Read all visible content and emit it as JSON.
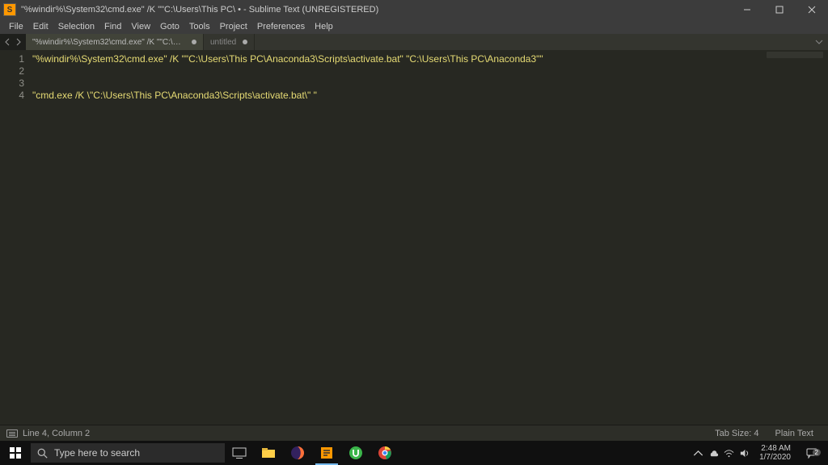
{
  "window": {
    "title": "\"%windir%\\System32\\cmd.exe\" /K \"\"C:\\Users\\This PC\\ • - Sublime Text (UNREGISTERED)",
    "app_icon_letter": "S"
  },
  "menu": {
    "items": [
      "File",
      "Edit",
      "Selection",
      "Find",
      "View",
      "Goto",
      "Tools",
      "Project",
      "Preferences",
      "Help"
    ]
  },
  "tabs": [
    {
      "label": "\"%windir%\\System32\\cmd.exe\" /K \"\"C:\\Users\\This PC\\",
      "active": true,
      "dirty": true
    },
    {
      "label": "untitled",
      "active": false,
      "dirty": true
    }
  ],
  "editor": {
    "lines": [
      "\"%windir%\\System32\\cmd.exe\" /K \"\"C:\\Users\\This PC\\Anaconda3\\Scripts\\activate.bat\" \"C:\\Users\\This PC\\Anaconda3\"\"",
      "",
      "",
      "\"cmd.exe /K \\\"C:\\Users\\This PC\\Anaconda3\\Scripts\\activate.bat\\\" \""
    ],
    "line_numbers": [
      "1",
      "2",
      "3",
      "4"
    ]
  },
  "status": {
    "position": "Line 4, Column 2",
    "tab_size": "Tab Size: 4",
    "syntax": "Plain Text"
  },
  "taskbar": {
    "search_placeholder": "Type here to search",
    "time": "2:48 AM",
    "date": "1/7/2020",
    "notif_count": "2",
    "apps": [
      "task-view",
      "file-explorer",
      "firefox",
      "sublime",
      "utorrent",
      "chrome"
    ]
  }
}
